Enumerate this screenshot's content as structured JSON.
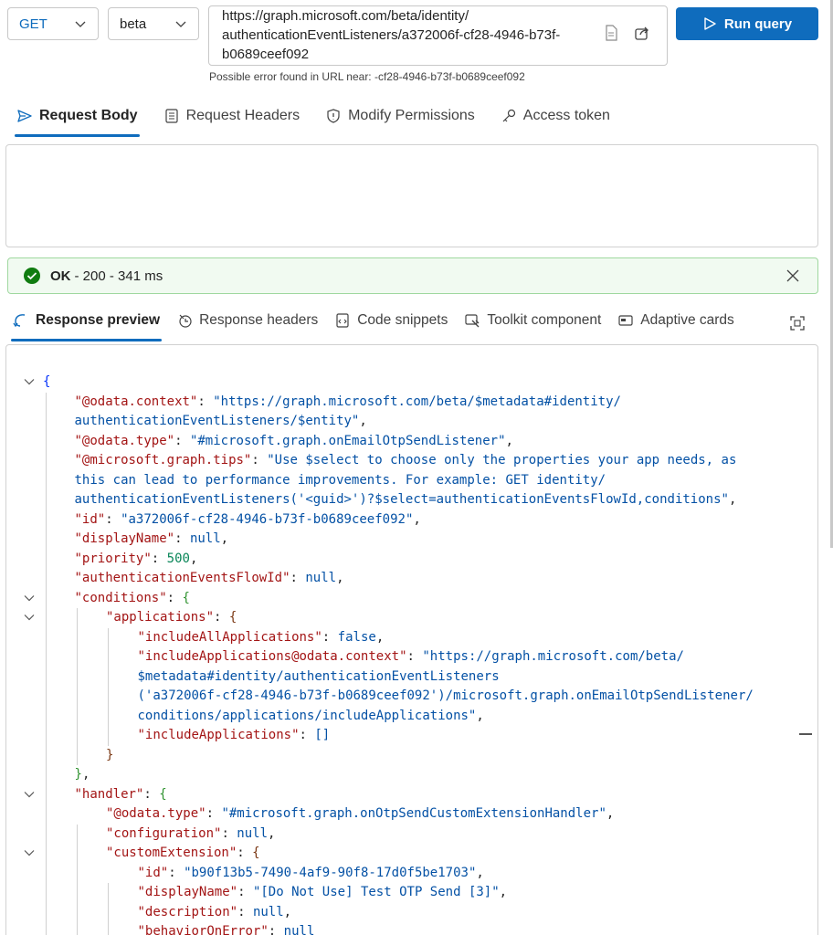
{
  "query": {
    "method": "GET",
    "version": "beta",
    "url": "https://graph.microsoft.com/beta/identity/authenticationEventListeners/a372006f-cf28-4946-b73f-b0689ceef092",
    "url_lines": [
      "https://graph.microsoft.com/beta/identity/",
      "authenticationEventListeners/a372006f-cf28-4946-b73f-",
      "b0689ceef092"
    ],
    "run_label": "Run query",
    "error_text": "Possible error found in URL near: -cf28-4946-b73f-b0689ceef092"
  },
  "request_tabs": [
    {
      "label": "Request Body",
      "icon": "send-icon",
      "active": true
    },
    {
      "label": "Request Headers",
      "icon": "document-icon",
      "active": false
    },
    {
      "label": "Modify Permissions",
      "icon": "shield-icon",
      "active": false
    },
    {
      "label": "Access token",
      "icon": "key-icon",
      "active": false
    }
  ],
  "status": {
    "ok": "OK",
    "detail": " - 200 - 341 ms",
    "color": "#107c10"
  },
  "response_tabs": [
    {
      "label": "Response preview",
      "icon": "arrow-icon",
      "active": true
    },
    {
      "label": "Response headers",
      "icon": "headers-icon",
      "active": false
    },
    {
      "label": "Code snippets",
      "icon": "code-icon",
      "active": false
    },
    {
      "label": "Toolkit component",
      "icon": "toolkit-icon",
      "active": false
    },
    {
      "label": "Adaptive cards",
      "icon": "card-icon",
      "active": false
    }
  ],
  "response_lines": [
    {
      "indent": 0,
      "fold": true,
      "parts": [
        [
          "br1",
          "{"
        ]
      ]
    },
    {
      "indent": 1,
      "fold": false,
      "parts": [
        [
          "k",
          "\"@odata.context\""
        ],
        [
          "p",
          ": "
        ],
        [
          "s",
          "\"https://graph.microsoft.com/beta/$metadata#identity/"
        ]
      ]
    },
    {
      "indent": 1,
      "fold": false,
      "parts": [
        [
          "s",
          "authenticationEventListeners/$entity\""
        ],
        [
          "p",
          ","
        ]
      ]
    },
    {
      "indent": 1,
      "fold": false,
      "parts": [
        [
          "k",
          "\"@odata.type\""
        ],
        [
          "p",
          ": "
        ],
        [
          "s",
          "\"#microsoft.graph.onEmailOtpSendListener\""
        ],
        [
          "p",
          ","
        ]
      ]
    },
    {
      "indent": 1,
      "fold": false,
      "parts": [
        [
          "k",
          "\"@microsoft.graph.tips\""
        ],
        [
          "p",
          ": "
        ],
        [
          "s",
          "\"Use $select to choose only the properties your app needs, as"
        ]
      ]
    },
    {
      "indent": 1,
      "fold": false,
      "parts": [
        [
          "s",
          "this can lead to performance improvements. For example: GET identity/"
        ]
      ]
    },
    {
      "indent": 1,
      "fold": false,
      "parts": [
        [
          "s",
          "authenticationEventListeners('<guid>')?$select=authenticationEventsFlowId,conditions\""
        ],
        [
          "p",
          ","
        ]
      ]
    },
    {
      "indent": 1,
      "fold": false,
      "parts": [
        [
          "k",
          "\"id\""
        ],
        [
          "p",
          ": "
        ],
        [
          "s",
          "\"a372006f-cf28-4946-b73f-b0689ceef092\""
        ],
        [
          "p",
          ","
        ]
      ]
    },
    {
      "indent": 1,
      "fold": false,
      "parts": [
        [
          "k",
          "\"displayName\""
        ],
        [
          "p",
          ": "
        ],
        [
          "b",
          "null"
        ],
        [
          "p",
          ","
        ]
      ]
    },
    {
      "indent": 1,
      "fold": false,
      "parts": [
        [
          "k",
          "\"priority\""
        ],
        [
          "p",
          ": "
        ],
        [
          "n",
          "500"
        ],
        [
          "p",
          ","
        ]
      ]
    },
    {
      "indent": 1,
      "fold": false,
      "parts": [
        [
          "k",
          "\"authenticationEventsFlowId\""
        ],
        [
          "p",
          ": "
        ],
        [
          "b",
          "null"
        ],
        [
          "p",
          ","
        ]
      ]
    },
    {
      "indent": 1,
      "fold": true,
      "parts": [
        [
          "k",
          "\"conditions\""
        ],
        [
          "p",
          ": "
        ],
        [
          "br2",
          "{"
        ]
      ]
    },
    {
      "indent": 2,
      "fold": true,
      "parts": [
        [
          "k",
          "\"applications\""
        ],
        [
          "p",
          ": "
        ],
        [
          "br3",
          "{"
        ]
      ]
    },
    {
      "indent": 3,
      "fold": false,
      "parts": [
        [
          "k",
          "\"includeAllApplications\""
        ],
        [
          "p",
          ": "
        ],
        [
          "b",
          "false"
        ],
        [
          "p",
          ","
        ]
      ]
    },
    {
      "indent": 3,
      "fold": false,
      "parts": [
        [
          "k",
          "\"includeApplications@odata.context\""
        ],
        [
          "p",
          ": "
        ],
        [
          "s",
          "\"https://graph.microsoft.com/beta/"
        ]
      ]
    },
    {
      "indent": 3,
      "fold": false,
      "parts": [
        [
          "s",
          "$metadata#identity/authenticationEventListeners"
        ]
      ]
    },
    {
      "indent": 3,
      "fold": false,
      "parts": [
        [
          "s",
          "('a372006f-cf28-4946-b73f-b0689ceef092')/microsoft.graph.onEmailOtpSendListener/"
        ]
      ]
    },
    {
      "indent": 3,
      "fold": false,
      "parts": [
        [
          "s",
          "conditions/applications/includeApplications\""
        ],
        [
          "p",
          ","
        ]
      ]
    },
    {
      "indent": 3,
      "fold": false,
      "parts": [
        [
          "k",
          "\"includeApplications\""
        ],
        [
          "p",
          ": "
        ],
        [
          "s",
          "[]"
        ]
      ]
    },
    {
      "indent": 2,
      "fold": false,
      "parts": [
        [
          "br3",
          "}"
        ]
      ]
    },
    {
      "indent": 1,
      "fold": false,
      "parts": [
        [
          "br2",
          "}"
        ],
        [
          "p",
          ","
        ]
      ]
    },
    {
      "indent": 1,
      "fold": true,
      "parts": [
        [
          "k",
          "\"handler\""
        ],
        [
          "p",
          ": "
        ],
        [
          "br2",
          "{"
        ]
      ]
    },
    {
      "indent": 2,
      "fold": false,
      "parts": [
        [
          "k",
          "\"@odata.type\""
        ],
        [
          "p",
          ": "
        ],
        [
          "s",
          "\"#microsoft.graph.onOtpSendCustomExtensionHandler\""
        ],
        [
          "p",
          ","
        ]
      ]
    },
    {
      "indent": 2,
      "fold": false,
      "parts": [
        [
          "k",
          "\"configuration\""
        ],
        [
          "p",
          ": "
        ],
        [
          "b",
          "null"
        ],
        [
          "p",
          ","
        ]
      ]
    },
    {
      "indent": 2,
      "fold": true,
      "parts": [
        [
          "k",
          "\"customExtension\""
        ],
        [
          "p",
          ": "
        ],
        [
          "br3",
          "{"
        ]
      ]
    },
    {
      "indent": 3,
      "fold": false,
      "parts": [
        [
          "k",
          "\"id\""
        ],
        [
          "p",
          ": "
        ],
        [
          "s",
          "\"b90f13b5-7490-4af9-90f8-17d0f5be1703\""
        ],
        [
          "p",
          ","
        ]
      ]
    },
    {
      "indent": 3,
      "fold": false,
      "parts": [
        [
          "k",
          "\"displayName\""
        ],
        [
          "p",
          ": "
        ],
        [
          "s",
          "\"[Do Not Use] Test OTP Send [3]\""
        ],
        [
          "p",
          ","
        ]
      ]
    },
    {
      "indent": 3,
      "fold": false,
      "parts": [
        [
          "k",
          "\"description\""
        ],
        [
          "p",
          ": "
        ],
        [
          "b",
          "null"
        ],
        [
          "p",
          ","
        ]
      ]
    },
    {
      "indent": 3,
      "fold": false,
      "parts": [
        [
          "k",
          "\"behaviorOnError\""
        ],
        [
          "p",
          ": "
        ],
        [
          "b",
          "null"
        ]
      ]
    }
  ]
}
